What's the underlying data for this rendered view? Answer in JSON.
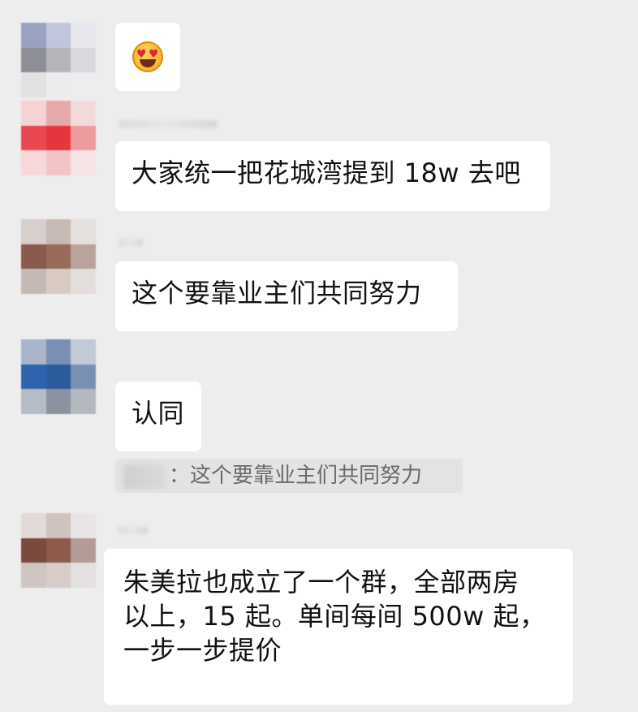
{
  "messages": [
    {
      "id": "m1",
      "text": "",
      "emoji": "smiling-face-with-heart-eyes"
    },
    {
      "id": "m2",
      "text": "大家统一把花城湾提到 18w 去吧"
    },
    {
      "id": "m3",
      "text": "这个要靠业主们共同努力"
    },
    {
      "id": "m4",
      "text": "认同",
      "quote": {
        "separator": "：",
        "text": "这个要靠业主们共同努力"
      }
    },
    {
      "id": "m5",
      "lines": [
        "朱美拉也成立了一个群，全部两房",
        "以上，15 起。单间每间 500w 起，",
        "一步一步提价"
      ]
    }
  ],
  "colors": {
    "background": "#ededed",
    "bubble": "#ffffff",
    "quote_background": "#e3e3e3",
    "quote_text": "#6a6a6a"
  }
}
